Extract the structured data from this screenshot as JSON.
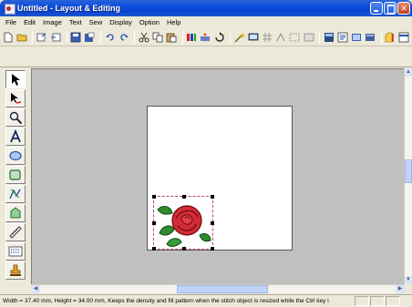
{
  "window": {
    "title": "Untitled - Layout & Editing",
    "buttons": [
      "minimize",
      "maximize",
      "close"
    ]
  },
  "menu": {
    "items": [
      {
        "label": "File"
      },
      {
        "label": "Edit"
      },
      {
        "label": "Image"
      },
      {
        "label": "Text"
      },
      {
        "label": "Sew"
      },
      {
        "label": "Display"
      },
      {
        "label": "Option"
      },
      {
        "label": "Help"
      }
    ]
  },
  "toolbar": {
    "icons": [
      "new-icon",
      "open-icon",
      "import-icon",
      "export-icon",
      "save-icon",
      "save-as-icon",
      "undo-icon",
      "redo-icon",
      "cut-icon",
      "copy-icon",
      "paste-icon",
      "stitch-icon",
      "send-icon",
      "rotate-icon",
      "wizard-icon",
      "display-icon",
      "grid-icon",
      "pattern-icon",
      "select-icon",
      "view-icon",
      "layout-icon",
      "properties-icon",
      "thread-icon",
      "card-icon"
    ]
  },
  "tools": [
    {
      "name": "select-tool",
      "active": true
    },
    {
      "name": "point-edit-tool"
    },
    {
      "name": "zoom-tool"
    },
    {
      "name": "text-tool"
    },
    {
      "name": "shape-tool"
    },
    {
      "name": "outline-tool"
    },
    {
      "name": "manual-punch-tool"
    },
    {
      "name": "stitch-edit-tool"
    },
    {
      "name": "measure-tool"
    },
    {
      "name": "arrange-tool"
    },
    {
      "name": "import-design-tool"
    }
  ],
  "status": {
    "text": "Width = 37.40 mm, Height = 34.00 mm, Keeps the density and fill pattern when the stitch object is resized while the Ctrl key i"
  },
  "colors": {
    "titlebar": "#0a52dc",
    "canvas": "#c0c0c0",
    "page": "#ffffff",
    "rose": "#d42a36",
    "leaves": "#2e8a2e"
  }
}
